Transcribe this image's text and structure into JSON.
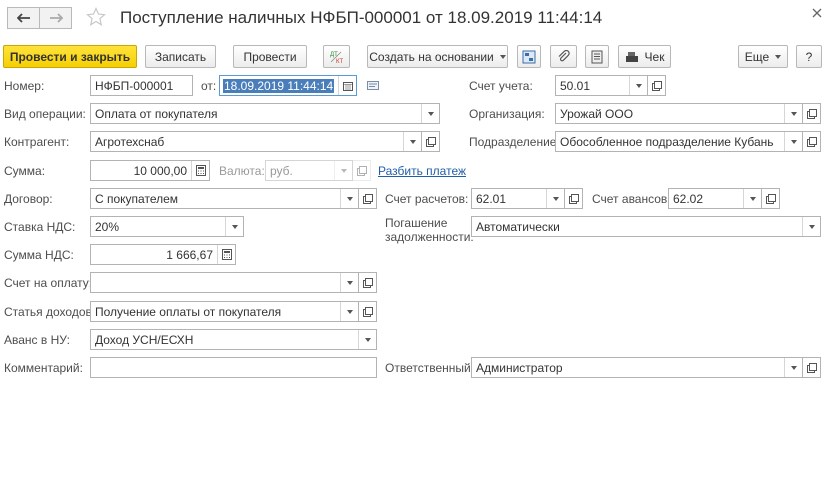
{
  "window": {
    "title": "Поступление наличных НФБП-000001 от 18.09.2019 11:44:14"
  },
  "toolbar": {
    "post_close": "Провести и закрыть",
    "save": "Записать",
    "post": "Провести",
    "dt_kt": "Дт Кт",
    "create_based": "Создать на основании",
    "receipt": "Чек",
    "more": "Еще",
    "help": "?"
  },
  "form": {
    "number": {
      "label": "Номер:",
      "value": "НФБП-000001"
    },
    "date": {
      "label": "от:",
      "value": "18.09.2019 11:44:14"
    },
    "account": {
      "label": "Счет учета:",
      "value": "50.01"
    },
    "operation": {
      "label": "Вид операции:",
      "value": "Оплата от покупателя"
    },
    "organization": {
      "label": "Организация:",
      "value": "Урожай ООО"
    },
    "counterparty": {
      "label": "Контрагент:",
      "value": "Агротехснаб"
    },
    "division": {
      "label": "Подразделение:",
      "value": "Обособленное подразделение Кубань"
    },
    "amount": {
      "label": "Сумма:",
      "value": "10 000,00"
    },
    "currency": {
      "label": "Валюта:",
      "value": "руб."
    },
    "split_payment": "Разбить платеж",
    "contract": {
      "label": "Договор:",
      "value": "С покупателем"
    },
    "settlement_account": {
      "label": "Счет расчетов:",
      "value": "62.01"
    },
    "advance_account": {
      "label": "Счет авансов:",
      "value": "62.02"
    },
    "vat_rate": {
      "label": "Ставка НДС:",
      "value": "20%"
    },
    "debt_repayment": {
      "label_line1": "Погашение",
      "label_line2": "задолженности:",
      "value": "Автоматически"
    },
    "vat_amount": {
      "label": "Сумма НДС:",
      "value": "1 666,67"
    },
    "invoice": {
      "label": "Счет на оплату:",
      "value": ""
    },
    "income_item": {
      "label": "Статья доходов:",
      "value": "Получение оплаты от покупателя"
    },
    "advance_tax": {
      "label": "Аванс в НУ:",
      "value": "Доход УСН/ЕСХН"
    },
    "comment": {
      "label": "Комментарий:",
      "value": ""
    },
    "responsible": {
      "label": "Ответственный:",
      "value": "Администратор"
    }
  }
}
